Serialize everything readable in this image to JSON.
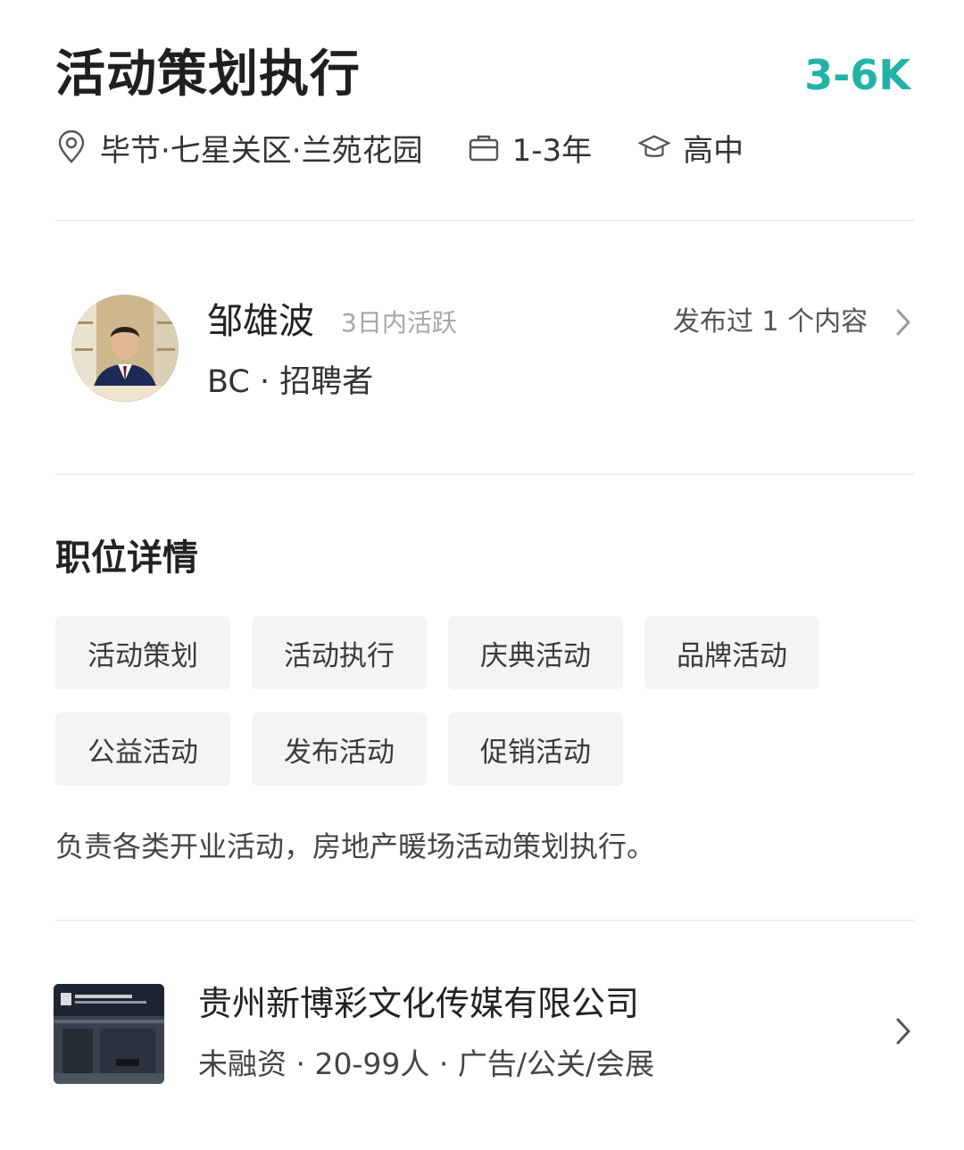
{
  "job": {
    "title": "活动策划执行",
    "salary": "3-6K",
    "location": "毕节·七星关区·兰苑花园",
    "experience": "1-3年",
    "education": "高中"
  },
  "recruiter": {
    "name": "邹雄波",
    "active_status": "3日内活跃",
    "posts": "发布过 1 个内容",
    "role": "BC · 招聘者"
  },
  "details": {
    "section_title": "职位详情",
    "tags": [
      "活动策划",
      "活动执行",
      "庆典活动",
      "品牌活动",
      "公益活动",
      "发布活动",
      "促销活动"
    ],
    "description": "负责各类开业活动，房地产暖场活动策划执行。"
  },
  "company": {
    "name": "贵州新博彩文化传媒有限公司",
    "info": "未融资 · 20-99人 · 广告/公关/会展"
  },
  "colors": {
    "accent": "#21b3a6",
    "tag_bg": "#f4f4f4",
    "divider": "#eeeeee"
  },
  "icons": {
    "location": "location-pin-icon",
    "experience": "briefcase-icon",
    "education": "graduation-cap-icon",
    "chevron": "chevron-right-icon"
  }
}
